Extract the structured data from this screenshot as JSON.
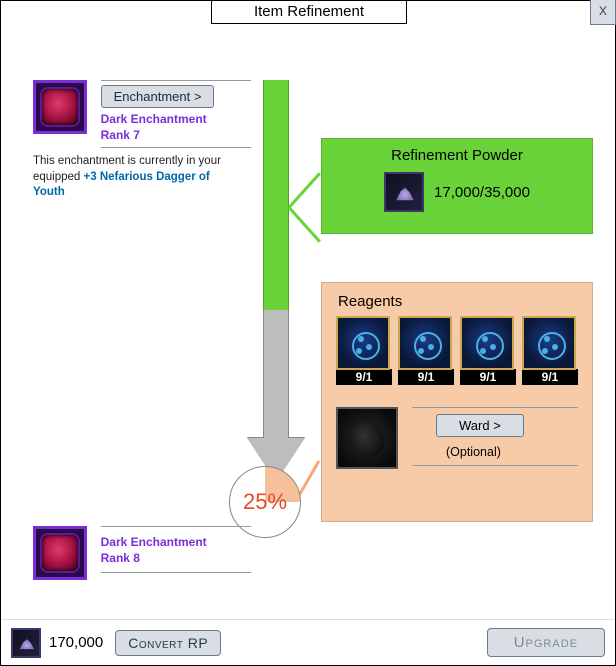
{
  "window": {
    "title": "Item Refinement",
    "close": "x"
  },
  "source_item": {
    "button_label": "Enchantment >",
    "name_line1": "Dark Enchantment",
    "name_line2": "Rank 7",
    "note_prefix": "This enchantment is currently in your equipped ",
    "note_link": "+3 Nefarious Dagger of Youth"
  },
  "result_item": {
    "name_line1": "Dark Enchantment",
    "name_line2": "Rank 8"
  },
  "powder_panel": {
    "title": "Refinement Powder",
    "amount": "17,000/35,000"
  },
  "reagents_panel": {
    "title": "Reagents",
    "counts": [
      "9/1",
      "9/1",
      "9/1",
      "9/1"
    ],
    "ward_button": "Ward >",
    "ward_optional": "(Optional)"
  },
  "success": {
    "percent_label": "25%",
    "percent_value": 25
  },
  "footer": {
    "rp_amount": "170,000",
    "convert_label": "Convert RP",
    "upgrade_label": "Upgrade"
  }
}
